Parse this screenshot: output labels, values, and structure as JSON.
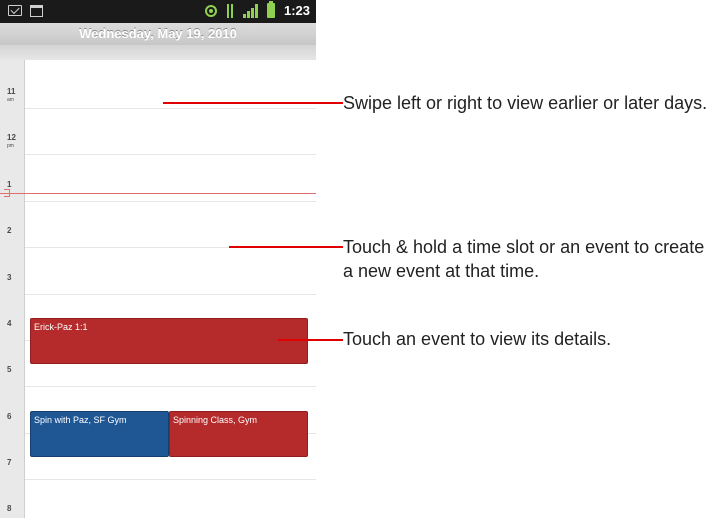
{
  "status_bar": {
    "time": "1:23",
    "icons": [
      "mail-icon",
      "calendar-icon",
      "gps-icon",
      "data-icon",
      "signal-icon",
      "battery-icon"
    ]
  },
  "calendar": {
    "date_header": "Wednesday, May 19, 2010",
    "hours": [
      {
        "label": "11",
        "ampm": "am"
      },
      {
        "label": "12",
        "ampm": "pm"
      },
      {
        "label": "1",
        "ampm": ""
      },
      {
        "label": "2",
        "ampm": ""
      },
      {
        "label": "3",
        "ampm": ""
      },
      {
        "label": "4",
        "ampm": ""
      },
      {
        "label": "5",
        "ampm": ""
      },
      {
        "label": "6",
        "ampm": ""
      },
      {
        "label": "7",
        "ampm": ""
      },
      {
        "label": "8",
        "ampm": ""
      }
    ],
    "events": [
      {
        "title": "Erick-Paz 1:1",
        "color": "#b52a2a"
      },
      {
        "title": "Spin with Paz, SF Gym",
        "color": "#1f5795"
      },
      {
        "title": "Spinning Class, Gym",
        "color": "#b52a2a"
      }
    ]
  },
  "annotations": [
    "Swipe left or right to view earlier or later days.",
    "Touch & hold a time slot or an event to create a new event at that time.",
    "Touch an event to view its details."
  ],
  "colors": {
    "pointer": "#e00000",
    "now_line": "#e07070",
    "status_icons": "#8fd14f"
  }
}
